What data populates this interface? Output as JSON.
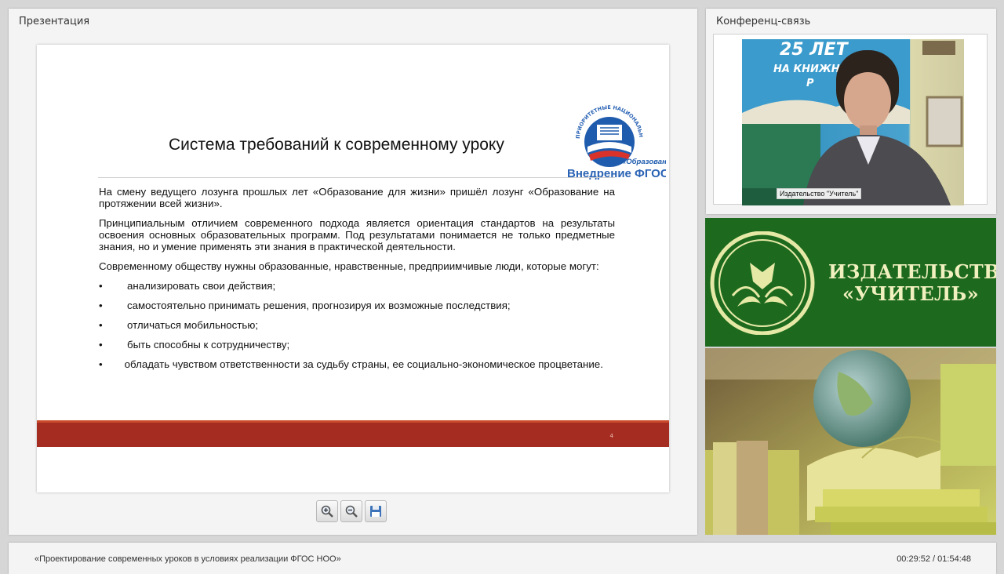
{
  "presentation_panel": {
    "title": "Презентация"
  },
  "slide": {
    "title": "Система требований к современному уроку",
    "paragraphs": [
      "На смену ведущего лозунга прошлых лет «Образование для жизни» пришёл лозунг «Образование на протяжении всей жизни».",
      "Принципиальным отличием современного подхода является ориентация стандартов на результаты освоения основных образовательных программ. Под результатами понимается не только предметные знания, но и умение применять эти знания в практической деятельности.",
      "Современному обществу нужны образованные, нравственные, предприимчивые люди, которые могут:"
    ],
    "bullets": [
      "анализировать свои действия;",
      "самостоятельно принимать решения, прогнозируя их возможные последствия;",
      "отличаться мобильностью;",
      "быть способны к сотрудничеству;",
      "обладать чувством ответственности за судьбу страны, ее социально-экономическое процветание."
    ],
    "bullet_symbol": "•",
    "page_number": "4",
    "logo": {
      "arc_text": "ПРИОРИТЕТНЫЕ НАЦИОНАЛЬНЫЕ ПРОЕКТЫ",
      "badge": "«Образование»",
      "caption": "Внедрение ФГОС"
    }
  },
  "toolbar": {
    "zoom_in_icon": "zoom-in-icon",
    "zoom_out_icon": "zoom-out-icon",
    "save_icon": "save-icon"
  },
  "conference_panel": {
    "title": "Конференц-связь",
    "camera_label": "Издательство \"Учитель\"",
    "banner_text_top": "25 ЛЕТ",
    "banner_text_mid": "НА КНИЖНОМ",
    "banner_text_end": "Р"
  },
  "brand": {
    "line1": "ИЗДАТЕЛЬСТВО",
    "line2": "«УЧИТЕЛЬ»"
  },
  "footer": {
    "course_title": "«Проектирование современных уроков в условиях реализации ФГОС НОО»",
    "time": "00:29:52 / 01:54:48"
  },
  "colors": {
    "slide_bar": "#a52c20",
    "brand_green": "#1d6a1f",
    "brand_text": "#f1f0bf"
  }
}
